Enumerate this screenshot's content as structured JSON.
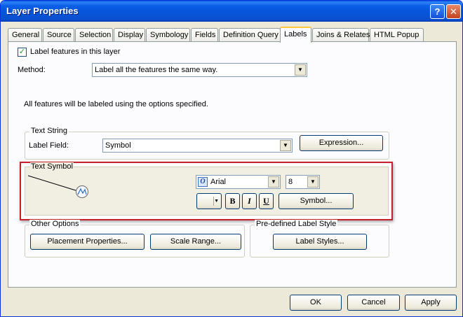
{
  "window": {
    "title": "Layer Properties",
    "help_label": "?",
    "close_label": "✕"
  },
  "tabs": [
    {
      "label": "General"
    },
    {
      "label": "Source"
    },
    {
      "label": "Selection"
    },
    {
      "label": "Display"
    },
    {
      "label": "Symbology"
    },
    {
      "label": "Fields"
    },
    {
      "label": "Definition Query"
    },
    {
      "label": "Labels",
      "active": true
    },
    {
      "label": "Joins & Relates"
    },
    {
      "label": "HTML Popup"
    }
  ],
  "labels_tab": {
    "label_features_checkbox": {
      "label": "Label features in this layer",
      "checked": true,
      "mark": "✓"
    },
    "method": {
      "label": "Method:",
      "value": "Label all the features the same way."
    },
    "info_text": "All features will be labeled using the options specified.",
    "text_string": {
      "legend": "Text String",
      "label_field_label": "Label Field:",
      "label_field_value": "Symbol",
      "expression_button": "Expression..."
    },
    "text_symbol": {
      "legend": "Text Symbol",
      "font_value": "Arial",
      "font_icon_glyph": "O",
      "size_value": "8",
      "bold_label": "B",
      "italic_label": "I",
      "underline_label": "U",
      "symbol_button": "Symbol..."
    },
    "other_options": {
      "legend": "Other Options",
      "placement_button": "Placement Properties...",
      "scale_range_button": "Scale Range..."
    },
    "predefined": {
      "legend": "Pre-defined Label Style",
      "label_styles_button": "Label Styles..."
    }
  },
  "footer": {
    "ok": "OK",
    "cancel": "Cancel",
    "apply": "Apply"
  },
  "colors": {
    "titlebar": "#0a5ee6",
    "highlight_box": "#c8202a"
  }
}
